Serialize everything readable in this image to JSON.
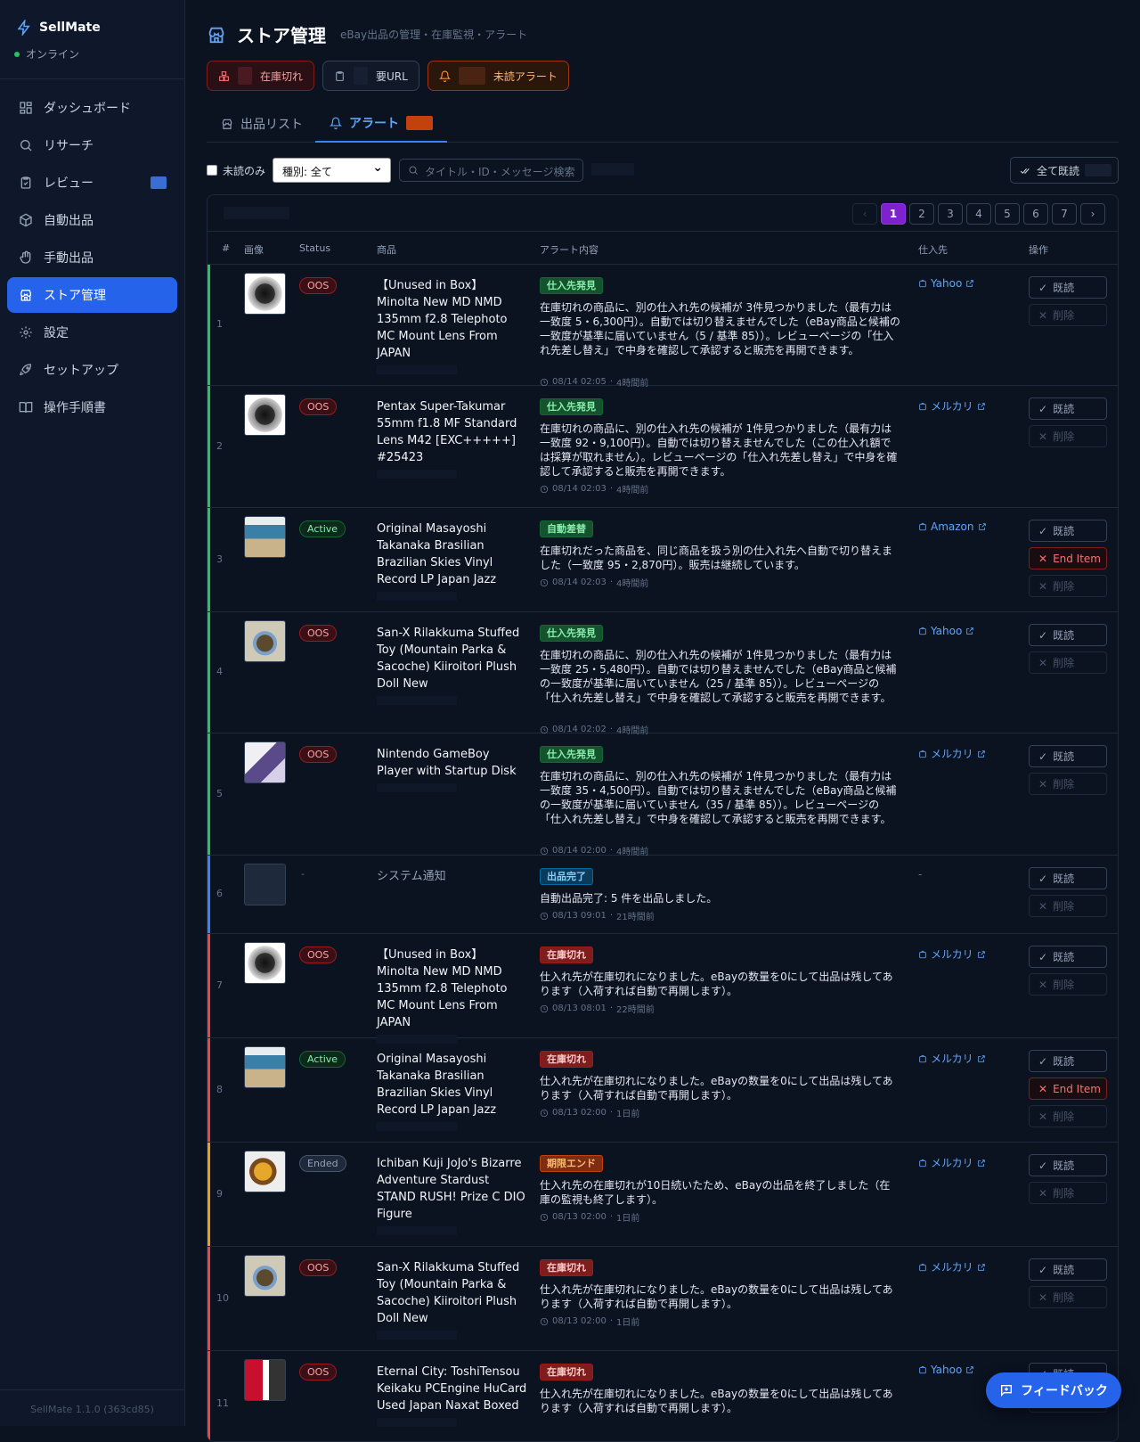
{
  "app": {
    "name": "SellMate",
    "status": "オンライン",
    "version": "SellMate 1.1.0 (363cd85)"
  },
  "nav": {
    "dashboard": "ダッシュボード",
    "research": "リサーチ",
    "review": "レビュー",
    "auto_listing": "自動出品",
    "manual_listing": "手動出品",
    "store": "ストア管理",
    "settings": "設定",
    "setup": "セットアップ",
    "manual": "操作手順書"
  },
  "header": {
    "title": "ストア管理",
    "subtitle": "eBay出品の管理・在庫監視・アラート"
  },
  "chips": {
    "oos": "在庫切れ",
    "need_url": "要URL",
    "unread": "未読アラート"
  },
  "tabs": {
    "listings": "出品リスト",
    "alerts": "アラート"
  },
  "filters": {
    "unread_only": "未読のみ",
    "type_select": "種別: 全て",
    "search_placeholder": "タイトル・ID・メッセージ検索",
    "mark_all": "全て既読"
  },
  "pagination": {
    "prev": "‹",
    "pages": [
      "1",
      "2",
      "3",
      "4",
      "5",
      "6",
      "7"
    ],
    "next": "›"
  },
  "columns": {
    "num": "#",
    "image": "画像",
    "status": "Status",
    "product": "商品",
    "alert": "アラート内容",
    "source": "仕入先",
    "actions": "操作"
  },
  "actions": {
    "read": "既読",
    "delete": "削除",
    "end_item": "End Item"
  },
  "colors": {
    "accent": "#2563eb",
    "oos": "#ef4444",
    "active": "#22c55e",
    "ended": "#64748b",
    "page_current": "#7e22ce"
  },
  "rows": [
    {
      "num": "1",
      "status": "OOS",
      "title": "【Unused in Box】 Minolta New MD NMD 135mm f2.8 Telephoto MC Mount Lens From JAPAN",
      "tag": "仕入先発見",
      "message": "在庫切れの商品に、別の仕入れ先の候補が 3件見つかりました（最有力は一致度 5・6,300円）。自動では切り替えませんでした（eBay商品と候補の一致度が基準に届いていません（5 / 基準 85））。レビューページの「仕入れ先差し替え」で中身を確認して承認すると販売を再開できます。",
      "time": "08/14 02:05",
      "ago": "4時間前",
      "source": "Yahoo"
    },
    {
      "num": "2",
      "status": "OOS",
      "title": "Pentax Super-Takumar 55mm f1.8 MF Standard Lens M42 [EXC+++++] #25423",
      "tag": "仕入先発見",
      "message": "在庫切れの商品に、別の仕入れ先の候補が 1件見つかりました（最有力は一致度 92・9,100円）。自動では切り替えませんでした（この仕入れ額では採算が取れません）。レビューページの「仕入れ先差し替え」で中身を確認して承認すると販売を再開できます。",
      "time": "08/14 02:03",
      "ago": "4時間前",
      "source": "メルカリ"
    },
    {
      "num": "3",
      "status": "Active",
      "title": "Original Masayoshi Takanaka Brasilian Brazilian Skies Vinyl Record LP Japan Jazz",
      "tag": "自動差替",
      "message": "在庫切れだった商品を、同じ商品を扱う別の仕入れ先へ自動で切り替えました（一致度 95・2,870円）。販売は継続しています。",
      "time": "08/14 02:03",
      "ago": "4時間前",
      "source": "Amazon"
    },
    {
      "num": "4",
      "status": "OOS",
      "title": "San-X Rilakkuma Stuffed Toy (Mountain Parka & Sacoche) Kiiroitori Plush Doll New",
      "tag": "仕入先発見",
      "message": "在庫切れの商品に、別の仕入れ先の候補が 1件見つかりました（最有力は一致度 25・5,480円）。自動では切り替えませんでした（eBay商品と候補の一致度が基準に届いていません（25 / 基準 85））。レビューページの「仕入れ先差し替え」で中身を確認して承認すると販売を再開できます。",
      "time": "08/14 02:02",
      "ago": "4時間前",
      "source": "Yahoo"
    },
    {
      "num": "5",
      "status": "OOS",
      "title": "Nintendo GameBoy Player with Startup Disk",
      "tag": "仕入先発見",
      "message": "在庫切れの商品に、別の仕入れ先の候補が 1件見つかりました（最有力は一致度 35・4,500円）。自動では切り替えませんでした（eBay商品と候補の一致度が基準に届いていません（35 / 基準 85））。レビューページの「仕入れ先差し替え」で中身を確認して承認すると販売を再開できます。",
      "time": "08/14 02:00",
      "ago": "4時間前",
      "source": "メルカリ"
    },
    {
      "num": "6",
      "status": "-",
      "title": "システム通知",
      "tag": "出品完了",
      "message": "自動出品完了: 5 件を出品しました。",
      "time": "08/13 09:01",
      "ago": "21時間前",
      "source": "-"
    },
    {
      "num": "7",
      "status": "OOS",
      "title": "【Unused in Box】 Minolta New MD NMD 135mm f2.8 Telephoto MC Mount Lens From JAPAN",
      "tag": "在庫切れ",
      "message": "仕入れ先が在庫切れになりました。eBayの数量を0にして出品は残してあります（入荷すれば自動で再開します）。",
      "time": "08/13 08:01",
      "ago": "22時間前",
      "source": "メルカリ"
    },
    {
      "num": "8",
      "status": "Active",
      "title": "Original Masayoshi Takanaka Brasilian Brazilian Skies Vinyl Record LP Japan Jazz",
      "tag": "在庫切れ",
      "message": "仕入れ先が在庫切れになりました。eBayの数量を0にして出品は残してあります（入荷すれば自動で再開します）。",
      "time": "08/13 02:00",
      "ago": "1日前",
      "source": "メルカリ"
    },
    {
      "num": "9",
      "status": "Ended",
      "title": "Ichiban Kuji JoJo's Bizarre Adventure Stardust STAND RUSH! Prize C DIO Figure",
      "tag": "期限エンド",
      "message": "仕入れ先の在庫切れが10日続いたため、eBayの出品を終了しました（在庫の監視も終了します）。",
      "time": "08/13 02:00",
      "ago": "1日前",
      "source": "メルカリ"
    },
    {
      "num": "10",
      "status": "OOS",
      "title": "San-X Rilakkuma Stuffed Toy (Mountain Parka & Sacoche) Kiiroitori Plush Doll New",
      "tag": "在庫切れ",
      "message": "仕入れ先が在庫切れになりました。eBayの数量を0にして出品は残してあります（入荷すれば自動で再開します）。",
      "time": "08/13 02:00",
      "ago": "1日前",
      "source": "メルカリ"
    },
    {
      "num": "11",
      "status": "OOS",
      "title": "Eternal City: ToshiTensou Keikaku PCEngine HuCard Used Japan Naxat Boxed",
      "tag": "在庫切れ",
      "message": "仕入れ先が在庫切れになりました。eBayの数量を0にして出品は残してあります（入荷すれば自動で再開します）。",
      "time": "",
      "ago": "",
      "source": "Yahoo"
    }
  ],
  "feedback": "フィードバック"
}
